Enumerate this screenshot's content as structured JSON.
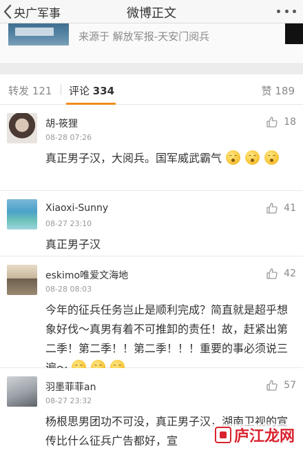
{
  "nav": {
    "back_label": "央广军事",
    "title": "微博正文"
  },
  "source": {
    "text": "来源于 解放军报-天安门阅兵"
  },
  "tabs": {
    "repost_label": "转发",
    "repost_count": "121",
    "comment_label": "评论",
    "comment_count": "334",
    "like_label": "赞",
    "like_count": "189"
  },
  "comments": [
    {
      "name": "胡-筱狸",
      "time": "08-28 07:26",
      "likes": "18",
      "text": "真正男子汉，大阅兵。国军威武霸气",
      "emoji_count": 3
    },
    {
      "name": "Xiaoxi-Sunny",
      "time": "08-27 23:10",
      "likes": "41",
      "text": "真正男子汉",
      "emoji_count": 0
    },
    {
      "name": "eskimo唯爱文海地",
      "time": "08-28 08:03",
      "likes": "42",
      "text": "今年的征兵任务岂止是顺利完成？简直就是超乎想象好伐～真男有着不可推卸的责任！故，赶紧出第二季！第二季！！第二季！！！重要的事必须说三遍～",
      "emoji_count": 3
    },
    {
      "name": "羽墨菲菲an",
      "time": "08-27 23:32",
      "likes": "57",
      "text": "杨根思男团功不可没，真正男子汉，湖南卫视的宣传比什么征兵广告都好，宣",
      "emoji_count": 0
    }
  ],
  "watermark": {
    "text": "庐江龙网"
  }
}
